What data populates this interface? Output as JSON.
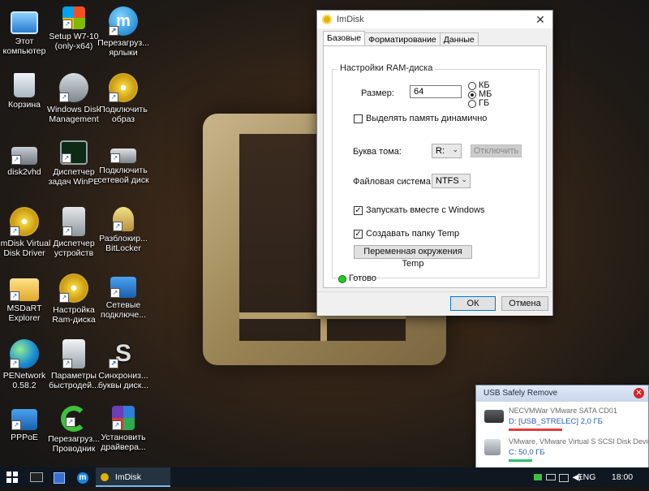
{
  "desktop_icons": [
    {
      "label": "Этот компьютер"
    },
    {
      "label": "Setup W7-10 (only-x64)"
    },
    {
      "label": "Перезагруз... ярлыки"
    },
    {
      "label": "Корзина"
    },
    {
      "label": "Windows Disk Management"
    },
    {
      "label": "Подключить образ"
    },
    {
      "label": "disk2vhd"
    },
    {
      "label": "Диспетчер задач WinPE"
    },
    {
      "label": "Подключить сетевой диск"
    },
    {
      "label": "ImDisk Virtual Disk Driver"
    },
    {
      "label": "Диспетчер устройств"
    },
    {
      "label": "Разблокир... BitLocker"
    },
    {
      "label": "MSDaRT Explorer"
    },
    {
      "label": "Настройка Ram-диска"
    },
    {
      "label": "Сетевые подключе..."
    },
    {
      "label": "PENetwork 0.58.2"
    },
    {
      "label": "Параметры быстродей..."
    },
    {
      "label": "Синхрониз... буквы диск..."
    },
    {
      "label": "PPPoE"
    },
    {
      "label": "Перезагруз... Проводник"
    },
    {
      "label": "Установить драйвера..."
    }
  ],
  "dialog": {
    "title": "ImDisk",
    "close_glyph": "✕",
    "tabs": [
      {
        "label": "Базовые"
      },
      {
        "label": "Форматирование"
      },
      {
        "label": "Данные"
      }
    ],
    "group_title": "Настройки RAM-диска",
    "size_label": "Размер:",
    "size_value": "64",
    "units": [
      {
        "label": "КБ",
        "selected": false
      },
      {
        "label": "МБ",
        "selected": true
      },
      {
        "label": "ГБ",
        "selected": false
      }
    ],
    "dynamic_label": "Выделять память динамично",
    "dynamic_checked": false,
    "drive_label": "Буква тома:",
    "drive_value": "R:",
    "unmount_label": "Отключить",
    "fs_label": "Файловая система:",
    "fs_value": "NTFS",
    "startup_label": "Запускать вместе с Windows",
    "startup_checked": true,
    "temp_label": "Создавать папку Temp",
    "temp_checked": true,
    "env_button": "Переменная окружения Temp",
    "status": "Готово",
    "ok": "ОК",
    "cancel": "Отмена"
  },
  "usb_popup": {
    "title": "USB Safely Remove",
    "devices": [
      {
        "name": "NECVMWar VMware SATA CD01",
        "drive": "D: [USB_STRELEC]  2,0 ГБ",
        "fill": 0.92,
        "bar_color": "#e33b3b"
      },
      {
        "name": "VMware, VMware Virtual S SCSI Disk Device",
        "drive": "C: 50,0 ГБ",
        "fill": 0.4,
        "bar_color": "#2fbf6c"
      }
    ]
  },
  "taskbar": {
    "active_app": "ImDisk",
    "lang": "ENG",
    "time": "18:00"
  }
}
